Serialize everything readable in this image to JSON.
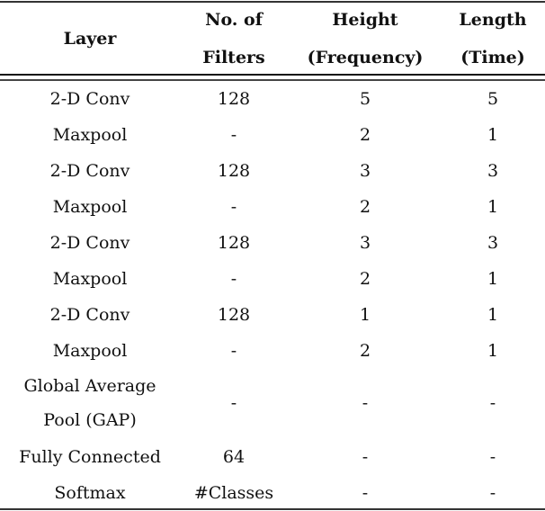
{
  "table": {
    "headers": [
      {
        "line1": "Layer",
        "line2": ""
      },
      {
        "line1": "No. of",
        "line2": "Filters"
      },
      {
        "line1": "Height",
        "line2": "(Frequency)"
      },
      {
        "line1": "Length",
        "line2": "(Time)"
      }
    ],
    "rows": [
      [
        "2-D Conv",
        "128",
        "5",
        "5"
      ],
      [
        "Maxpool",
        "-",
        "2",
        "1"
      ],
      [
        "2-D Conv",
        "128",
        "3",
        "3"
      ],
      [
        "Maxpool",
        "-",
        "2",
        "1"
      ],
      [
        "2-D Conv",
        "128",
        "3",
        "3"
      ],
      [
        "Maxpool",
        "-",
        "2",
        "1"
      ],
      [
        "2-D Conv",
        "128",
        "1",
        "1"
      ],
      [
        "Maxpool",
        "-",
        "2",
        "1"
      ],
      [
        "Global Average",
        "-",
        "-",
        "-"
      ],
      [
        "Fully Connected",
        "64",
        "-",
        "-"
      ],
      [
        "Softmax",
        "#Classes",
        "-",
        "-"
      ]
    ],
    "gap_second_line": "Pool (GAP)"
  }
}
